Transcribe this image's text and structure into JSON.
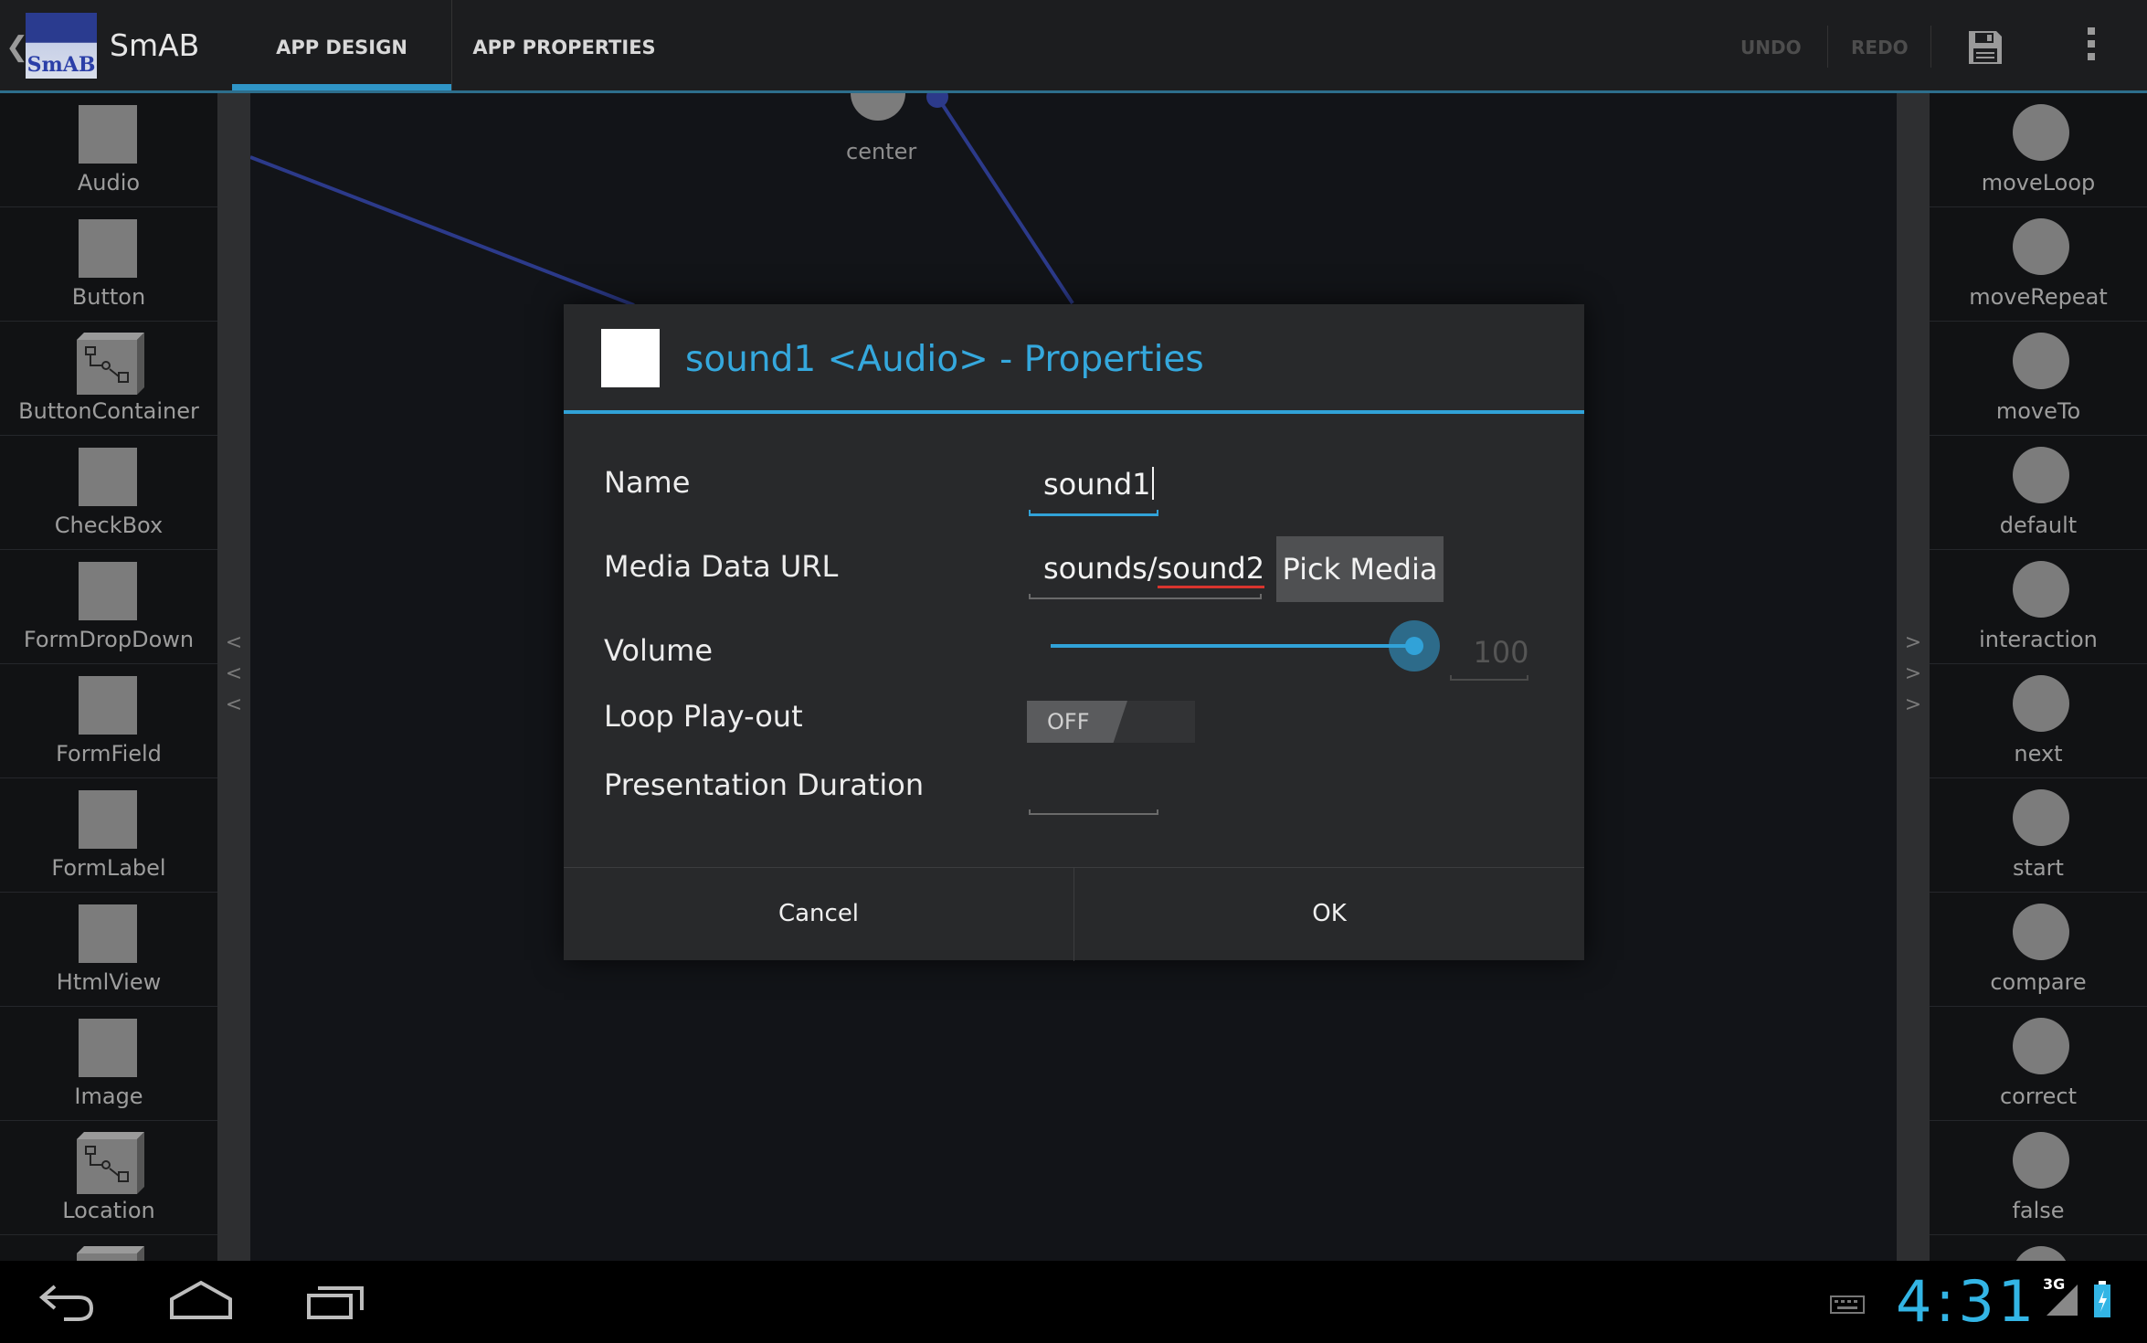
{
  "actionbar": {
    "app_icon_label": "SmAB",
    "app_title": "SmAB",
    "tabs": [
      "APP DESIGN",
      "APP PROPERTIES"
    ],
    "actions": [
      "UNDO",
      "REDO"
    ],
    "icons": [
      "save-icon",
      "overflow-menu-icon"
    ]
  },
  "left_palette": [
    {
      "label": "Audio",
      "icon": "square"
    },
    {
      "label": "Button",
      "icon": "square"
    },
    {
      "label": "ButtonContainer",
      "icon": "container-box"
    },
    {
      "label": "CheckBox",
      "icon": "square"
    },
    {
      "label": "FormDropDown",
      "icon": "square"
    },
    {
      "label": "FormField",
      "icon": "square"
    },
    {
      "label": "FormLabel",
      "icon": "square"
    },
    {
      "label": "HtmlView",
      "icon": "square"
    },
    {
      "label": "Image",
      "icon": "square"
    },
    {
      "label": "Location",
      "icon": "container-box"
    }
  ],
  "right_palette": [
    {
      "label": "moveLoop"
    },
    {
      "label": "moveRepeat"
    },
    {
      "label": "moveTo"
    },
    {
      "label": "default"
    },
    {
      "label": "interaction"
    },
    {
      "label": "next"
    },
    {
      "label": "start"
    },
    {
      "label": "compare"
    },
    {
      "label": "correct"
    },
    {
      "label": "false"
    }
  ],
  "canvas": {
    "node_label": "center"
  },
  "dialog": {
    "title": "sound1 <Audio> - Properties",
    "fields": {
      "name_label": "Name",
      "name_value": "sound1",
      "url_label": "Media Data URL",
      "url_value_prefix": "sounds/",
      "url_value_misspelled": "sound2",
      "pick_media": "Pick Media",
      "volume_label": "Volume",
      "volume_value": "100",
      "volume_level": 1.0,
      "loop_label": "Loop Play-out",
      "loop_state": "OFF",
      "duration_label": "Presentation Duration",
      "duration_value": ""
    },
    "buttons": {
      "cancel": "Cancel",
      "ok": "OK"
    },
    "accent_color": "#31a2d8"
  },
  "system_bar": {
    "clock": "4:31",
    "network": "3G",
    "nav_icons": [
      "back-icon",
      "home-icon",
      "recent-apps-icon"
    ]
  }
}
